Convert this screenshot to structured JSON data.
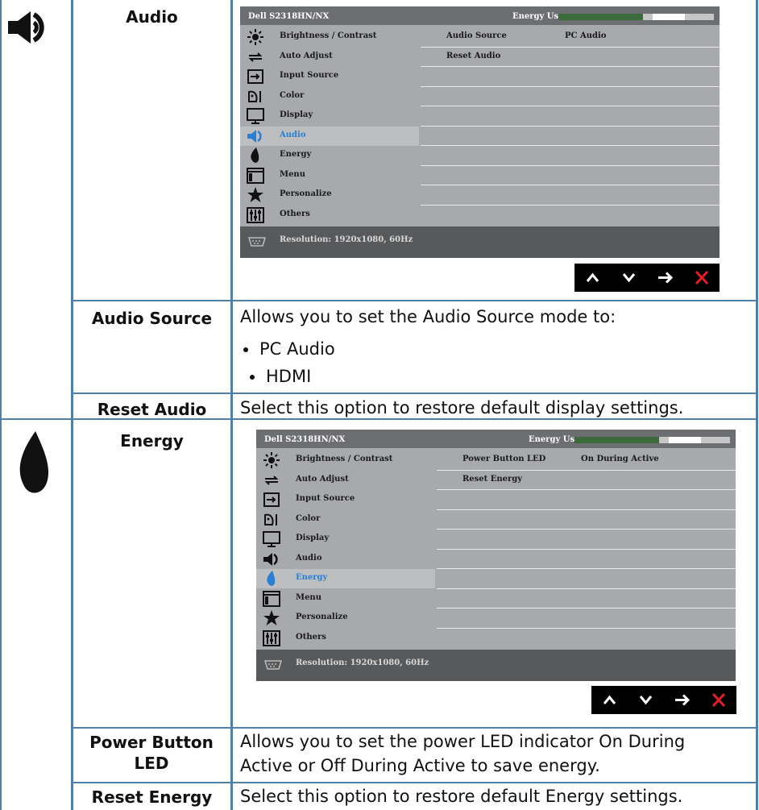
{
  "sections": [
    {
      "key": "audio",
      "side_icon": "speaker-icon",
      "title": "Audio",
      "osd": {
        "model": "Dell S2318HN/NX",
        "energy_label": "Energy Use",
        "energy_level": 0.7,
        "menu": [
          {
            "label": "Brightness / Contrast",
            "icon": "brightness-icon"
          },
          {
            "label": "Auto Adjust",
            "icon": "auto-adjust-icon"
          },
          {
            "label": "Input Source",
            "icon": "input-source-icon"
          },
          {
            "label": "Color",
            "icon": "color-icon"
          },
          {
            "label": "Display",
            "icon": "display-icon"
          },
          {
            "label": "Audio",
            "icon": "speaker-icon"
          },
          {
            "label": "Energy",
            "icon": "energy-icon"
          },
          {
            "label": "Menu",
            "icon": "menu-icon"
          },
          {
            "label": "Personalize",
            "icon": "star-icon"
          },
          {
            "label": "Others",
            "icon": "others-icon"
          }
        ],
        "active_index": 5,
        "panel": [
          {
            "label": "Audio Source",
            "value": "PC Audio"
          },
          {
            "label": "Reset Audio",
            "value": ""
          }
        ],
        "status": "Resolution: 1920x1080, 60Hz"
      },
      "rows": [
        {
          "title": "Audio Source",
          "desc": "Allows you to set the Audio Source mode to:",
          "bullets": [
            "PC Audio",
            "HDMI"
          ]
        },
        {
          "title": "Reset Audio",
          "desc": "Select this option to restore default display settings.",
          "bullets": []
        }
      ]
    },
    {
      "key": "energy",
      "side_icon": "energy-icon",
      "title": "Energy",
      "osd": {
        "model": "Dell S2318HN/NX",
        "energy_label": "Energy Use",
        "energy_level": 0.7,
        "menu": [
          {
            "label": "Brightness / Contrast",
            "icon": "brightness-icon"
          },
          {
            "label": "Auto Adjust",
            "icon": "auto-adjust-icon"
          },
          {
            "label": "Input Source",
            "icon": "input-source-icon"
          },
          {
            "label": "Color",
            "icon": "color-icon"
          },
          {
            "label": "Display",
            "icon": "display-icon"
          },
          {
            "label": "Audio",
            "icon": "speaker-icon"
          },
          {
            "label": "Energy",
            "icon": "energy-icon"
          },
          {
            "label": "Menu",
            "icon": "menu-icon"
          },
          {
            "label": "Personalize",
            "icon": "star-icon"
          },
          {
            "label": "Others",
            "icon": "others-icon"
          }
        ],
        "active_index": 6,
        "panel": [
          {
            "label": "Power Button LED",
            "value": "On During Active"
          },
          {
            "label": "Reset Energy",
            "value": ""
          }
        ],
        "status": "Resolution: 1920x1080, 60Hz"
      },
      "rows": [
        {
          "title": "Power Button LED",
          "desc": "Allows you to set the power LED indicator On During Active or Off During Active to save energy.",
          "bullets": []
        },
        {
          "title": "Reset Energy",
          "desc": "Select this option to restore default Energy settings.",
          "bullets": []
        }
      ]
    }
  ],
  "nav_buttons": [
    {
      "name": "up-arrow-icon",
      "glyph": "up"
    },
    {
      "name": "down-arrow-icon",
      "glyph": "down"
    },
    {
      "name": "right-arrow-icon",
      "glyph": "right"
    },
    {
      "name": "close-icon",
      "glyph": "close"
    }
  ],
  "colors": {
    "grid": "#4f7fa8",
    "highlight_blue": "#2a7fd4",
    "close_red": "#e31e24",
    "energy_green": "#3b6b3b"
  }
}
